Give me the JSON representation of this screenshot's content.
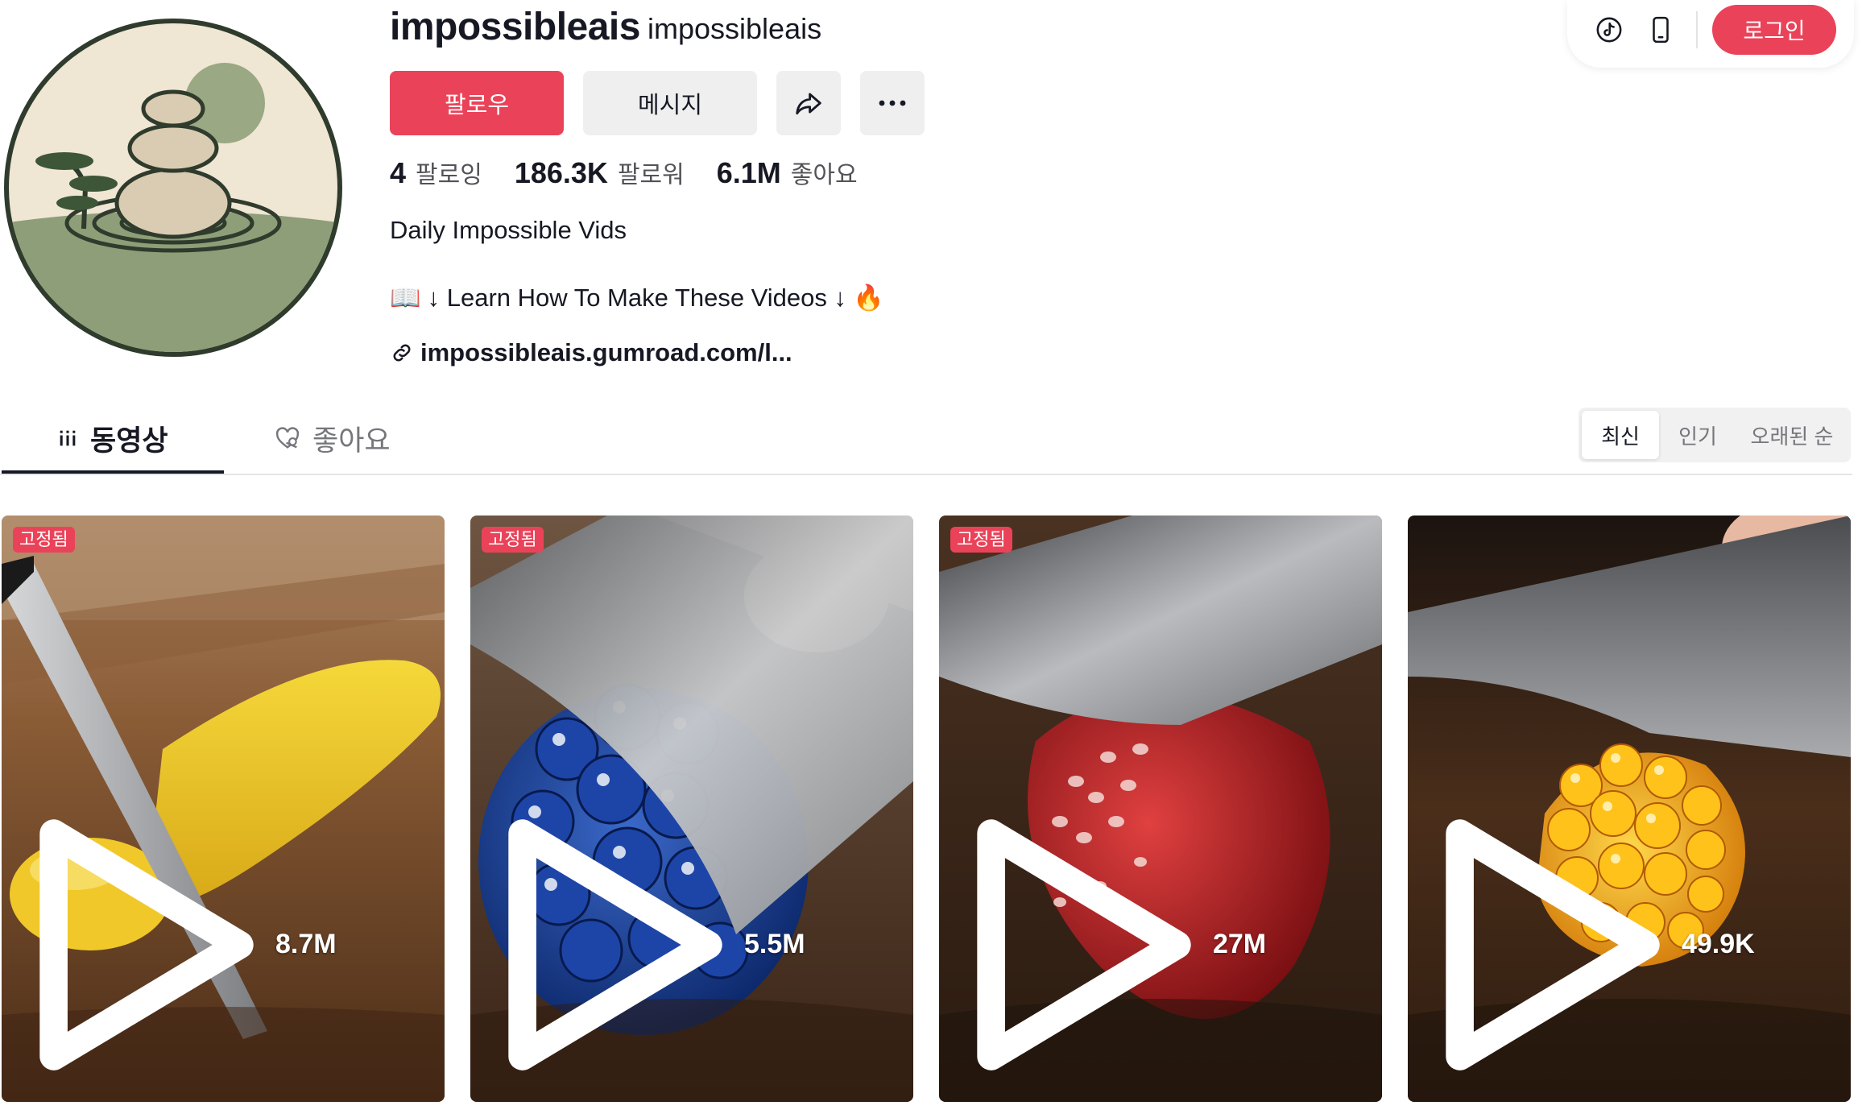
{
  "profile": {
    "unique_id": "impossibleais",
    "nickname": "impossibleais",
    "follow_label": "팔로우",
    "message_label": "메시지",
    "stats": {
      "following_count": "4",
      "following_label": "팔로잉",
      "followers_count": "186.3K",
      "followers_label": "팔로워",
      "likes_count": "6.1M",
      "likes_label": "좋아요"
    },
    "bio_line1": "Daily Impossible Vids",
    "bio_line2": "↓ Learn How To Make These Videos ↓",
    "bio_emoji_book": "📖",
    "bio_emoji_fire": "🔥",
    "link": "impossibleais.gumroad.com/l..."
  },
  "header": {
    "login_label": "로그인"
  },
  "tabs": [
    {
      "label": "동영상",
      "active": true
    },
    {
      "label": "좋아요",
      "active": false
    }
  ],
  "sort": [
    {
      "label": "최신",
      "active": true
    },
    {
      "label": "인기",
      "active": false
    },
    {
      "label": "오래된 순",
      "active": false
    }
  ],
  "videos": [
    {
      "pinned_label": "고정됨",
      "views": "8.7M",
      "subject": "yellow glass banana"
    },
    {
      "pinned_label": "고정됨",
      "views": "5.5M",
      "subject": "blue glass blackberry"
    },
    {
      "pinned_label": "고정됨",
      "views": "27M",
      "subject": "red glass strawberry"
    },
    {
      "pinned_label": "",
      "views": "49.9K",
      "subject": "golden glass raspberry"
    }
  ],
  "colors": {
    "accent": "#ea4359",
    "text_primary": "#161823",
    "text_secondary": "#75767b",
    "button_gray": "#efefef"
  }
}
